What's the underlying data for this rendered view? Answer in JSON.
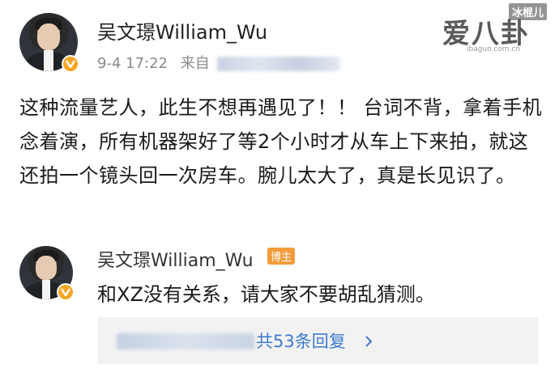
{
  "post": {
    "username": "吴文璟William_Wu",
    "timestamp": "9-4 17:22",
    "source_prefix": "来自",
    "body": "这种流量艺人，此生不想再遇见了！！ 台词不背，拿着手机念着演，所有机器架好了等2个小时才从车上下来拍，就这还拍一个镜头回一次房车。腕儿太大了，真是长见识了。"
  },
  "reply": {
    "username": "吴文璟William_Wu",
    "badge": "博主",
    "text": "和XZ没有关系，请大家不要胡乱猜测。",
    "replies_count": "共53条回复"
  },
  "watermark": {
    "logo": "爱八卦",
    "tag": "冰棍儿",
    "url": "ibaguo.com.cn"
  },
  "icons": {
    "verified": "verified-v-icon",
    "chevron": "chevron-right-icon"
  },
  "colors": {
    "verified_badge": "#f6a623",
    "blogger_badge": "#f39c3c",
    "link_blue": "#3d7bcf"
  }
}
